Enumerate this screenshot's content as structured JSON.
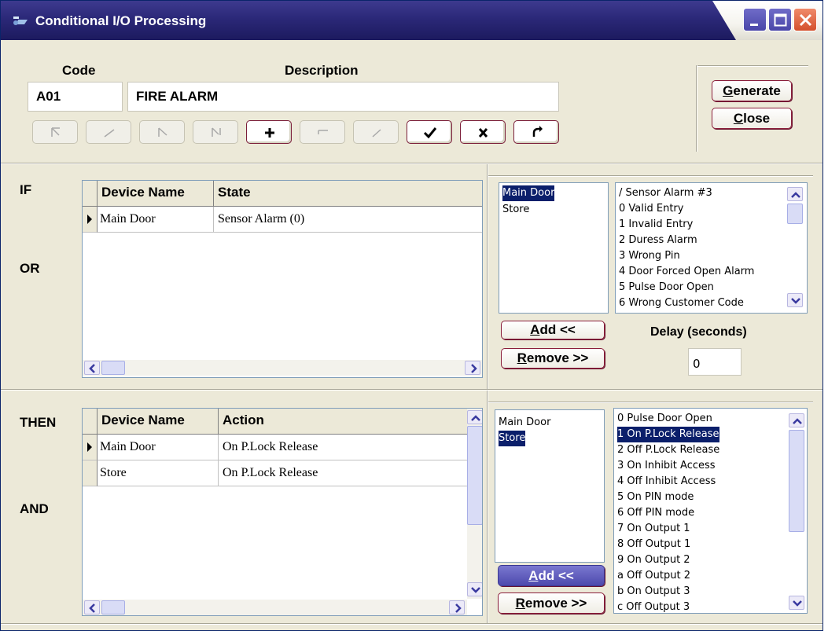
{
  "window": {
    "title": "Conditional I/O Processing",
    "controls": [
      "minimize-icon",
      "maximize-icon",
      "close-icon"
    ]
  },
  "header": {
    "code_label": "Code",
    "description_label": "Description",
    "code_value": "A01",
    "description_value": "FIRE ALARM",
    "nav_buttons": [
      "first-icon",
      "prev-icon",
      "next-icon",
      "last-icon",
      "add-icon",
      "delete-icon",
      "edit-icon",
      "confirm-icon",
      "cancel-icon",
      "refresh-icon"
    ]
  },
  "actions": {
    "generate": "Generate",
    "close": "Close"
  },
  "if_section": {
    "if_label": "IF",
    "or_label": "OR",
    "grid": {
      "columns": [
        "Device Name",
        "State"
      ],
      "rows": [
        {
          "device": "Main Door",
          "value": "Sensor Alarm (0)"
        }
      ]
    },
    "devices": [
      {
        "label": "Main Door",
        "selected": true
      },
      {
        "label": "Store",
        "selected": false
      }
    ],
    "states": [
      {
        "label": "/ Sensor Alarm #3",
        "selected": false
      },
      {
        "label": "0 Valid Entry",
        "selected": false
      },
      {
        "label": "1 Invalid Entry",
        "selected": false
      },
      {
        "label": "2 Duress Alarm",
        "selected": false
      },
      {
        "label": "3 Wrong Pin",
        "selected": false
      },
      {
        "label": "4 Door Forced Open Alarm",
        "selected": false
      },
      {
        "label": "5 Pulse Door Open",
        "selected": false
      },
      {
        "label": "6 Wrong Customer Code",
        "selected": false
      }
    ],
    "add_label": "Add <<",
    "remove_label": "Remove >>",
    "delay_label": "Delay (seconds)",
    "delay_value": "0"
  },
  "then_section": {
    "then_label": "THEN",
    "and_label": "AND",
    "grid": {
      "columns": [
        "Device Name",
        "Action"
      ],
      "rows": [
        {
          "device": "Main Door",
          "value": "On P.Lock Release"
        },
        {
          "device": "Store",
          "value": "On P.Lock Release"
        }
      ]
    },
    "devices": [
      {
        "label": "Main Door",
        "selected": false
      },
      {
        "label": "Store",
        "selected": true
      }
    ],
    "actions": [
      {
        "label": "0 Pulse Door Open",
        "selected": false
      },
      {
        "label": "1 On P.Lock Release",
        "selected": true
      },
      {
        "label": "2 Off P.Lock Release",
        "selected": false
      },
      {
        "label": "3 On Inhibit Access",
        "selected": false
      },
      {
        "label": "4 Off Inhibit Access",
        "selected": false
      },
      {
        "label": "5 On PIN mode",
        "selected": false
      },
      {
        "label": "6 Off PIN mode",
        "selected": false
      },
      {
        "label": "7 On Output 1",
        "selected": false
      },
      {
        "label": "8 Off Output 1",
        "selected": false
      },
      {
        "label": "9 On Output 2",
        "selected": false
      },
      {
        "label": "a Off Output 2",
        "selected": false
      },
      {
        "label": "b On Output 3",
        "selected": false
      },
      {
        "label": "c Off Output 3",
        "selected": false
      }
    ],
    "add_label": "Add <<",
    "remove_label": "Remove >>"
  },
  "colors": {
    "titlebar": "#2b2878",
    "selection": "#0b1f6b",
    "button_border": "#8a1e3b"
  }
}
